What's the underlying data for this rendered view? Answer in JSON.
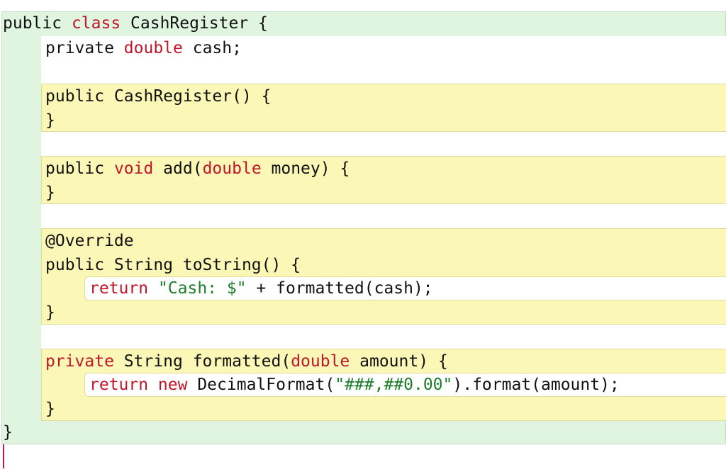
{
  "editor": {
    "lines": [
      {
        "a": "public ",
        "b": "class",
        "c": " CashRegister {"
      },
      {
        "a": "private ",
        "b": "double",
        "c": " cash;"
      },
      {
        "a": "public CashRegister() {"
      },
      {
        "a": "}"
      },
      {
        "a": "public ",
        "b": "void",
        "c": " add(",
        "d": "double",
        "e": " money) {"
      },
      {
        "a": "}"
      },
      {
        "a": "@Override"
      },
      {
        "a": "public String toString() {"
      },
      {
        "a": "return ",
        "b": "\"Cash: $\"",
        "c": " + formatted(cash);"
      },
      {
        "a": "}"
      },
      {
        "a": "private String formatted(",
        "b": "double",
        "c": " amount) {"
      },
      {
        "a": "return new DecimalFormat(",
        "b": "\"###,##0.00\"",
        "c": ").format(amount);"
      },
      {
        "a": "}"
      },
      {
        "a": "}"
      }
    ]
  },
  "colors": {
    "class_block": "#dff5df",
    "method_block": "#fbf7b7",
    "statement_block": "#ffffff",
    "keyword": "#c0162a",
    "string_literal": "#1e7d2a",
    "cursor": "#c2185b"
  }
}
